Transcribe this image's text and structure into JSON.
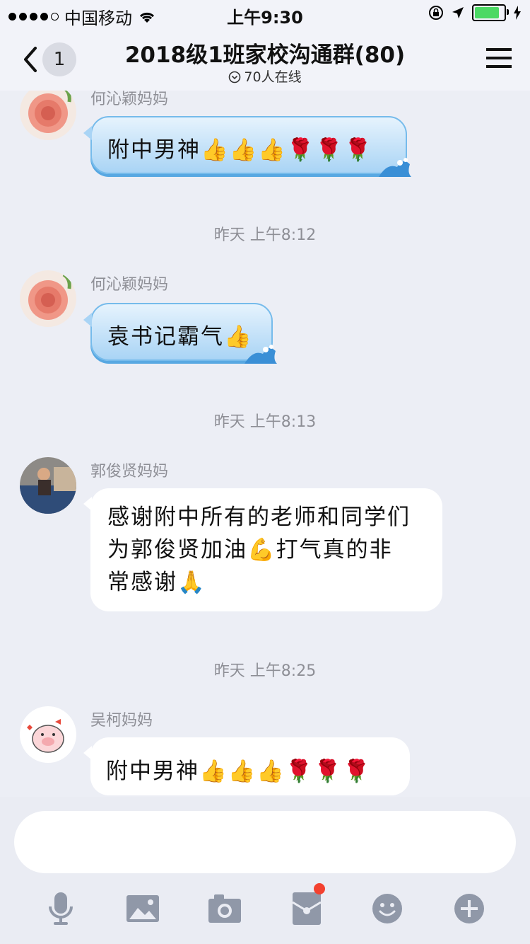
{
  "status_bar": {
    "carrier": "中国移动",
    "time": "上午9:30",
    "battery_level": 0.78
  },
  "header": {
    "unread_count": "1",
    "title": "2018级1班家校沟通群(80)",
    "online": "70人在线"
  },
  "messages": [
    {
      "sender": "何沁颖妈妈",
      "text": "附中男神👍👍👍🌹🌹🌹",
      "style": "blue"
    },
    {
      "timestamp": "昨天 上午8:12"
    },
    {
      "sender": "何沁颖妈妈",
      "text": "袁书记霸气👍",
      "style": "blue"
    },
    {
      "timestamp": "昨天 上午8:13"
    },
    {
      "sender": "郭俊贤妈妈",
      "lines": [
        "感谢附中所有的老师和同学们",
        "为郭俊贤加油💪打气真的非",
        "常感谢🙏"
      ],
      "style": "white"
    },
    {
      "timestamp": "昨天 上午8:25"
    },
    {
      "sender": "吴柯妈妈",
      "text": "附中男神👍👍👍🌹🌹🌹",
      "style": "white"
    }
  ],
  "input": {
    "placeholder": ""
  },
  "toolbar": {
    "icons": [
      "microphone-icon",
      "image-icon",
      "camera-icon",
      "red-envelope-icon",
      "emoji-icon",
      "plus-icon"
    ]
  },
  "colors": {
    "accent_blue": "#76bbeb",
    "badge_red": "#f3412f",
    "background": "#eceef5"
  }
}
